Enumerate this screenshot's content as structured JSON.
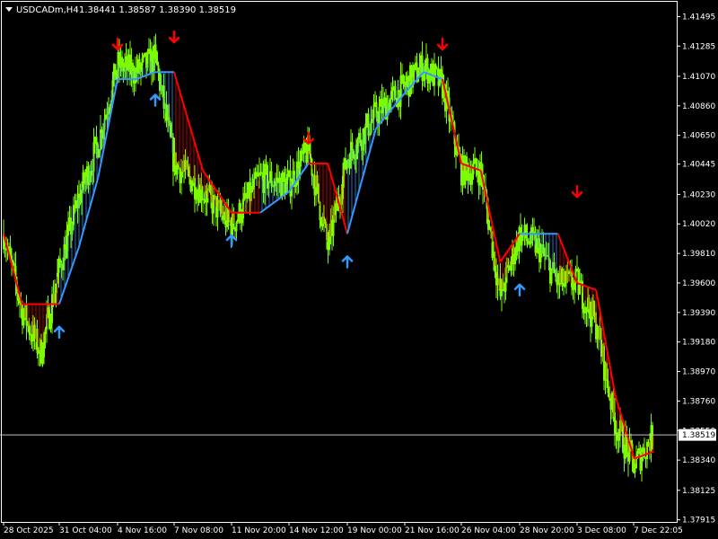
{
  "header": {
    "symbol_timeframe": "USDCADm,H4",
    "ohlc": "1.38441 1.38587 1.38390 1.38519"
  },
  "colors": {
    "background": "#000000",
    "candles": "#7CFC00",
    "trend_up": "#3399ff",
    "trend_down": "#ff0000",
    "arrow_up": "#3399ff",
    "arrow_down": "#ff0000",
    "price_line": "#c0c0c0",
    "axis": "#ffffff"
  },
  "chart_data": {
    "type": "line",
    "title": "",
    "ylim": [
      1.379,
      1.416
    ],
    "y_ticks": [
      "1.41495",
      "1.41285",
      "1.41070",
      "1.40860",
      "1.40650",
      "1.40445",
      "1.40230",
      "1.40020",
      "1.39810",
      "1.39600",
      "1.39390",
      "1.39180",
      "1.38970",
      "1.38760",
      "1.38550",
      "1.38340",
      "1.38125",
      "1.37915"
    ],
    "x_ticks": [
      "28 Oct 2025",
      "31 Oct 04:00",
      "4 Nov 16:00",
      "7 Nov 08:00",
      "11 Nov 20:00",
      "14 Nov 12:00",
      "19 Nov 00:00",
      "21 Nov 16:00",
      "26 Nov 04:00",
      "28 Nov 20:00",
      "3 Dec 08:00",
      "7 Dec 22:05"
    ],
    "current_price": "1.38519",
    "price_path": [
      {
        "t": "28 Oct 2025",
        "v": 1.3995
      },
      {
        "t": "29 Oct 2025",
        "v": 1.394
      },
      {
        "t": "30 Oct 2025",
        "v": 1.391
      },
      {
        "t": "31 Oct 04:00",
        "v": 1.397
      },
      {
        "t": "1 Nov",
        "v": 1.402
      },
      {
        "t": "3 Nov",
        "v": 1.406
      },
      {
        "t": "4 Nov 16:00",
        "v": 1.4115
      },
      {
        "t": "5 Nov",
        "v": 1.411
      },
      {
        "t": "6 Nov",
        "v": 1.412
      },
      {
        "t": "7 Nov 08:00",
        "v": 1.4045
      },
      {
        "t": "10 Nov",
        "v": 1.4025
      },
      {
        "t": "11 Nov 20:00",
        "v": 1.4
      },
      {
        "t": "13 Nov",
        "v": 1.4035
      },
      {
        "t": "14 Nov 12:00",
        "v": 1.403
      },
      {
        "t": "17 Nov",
        "v": 1.4055
      },
      {
        "t": "18 Nov",
        "v": 1.3985
      },
      {
        "t": "19 Nov 00:00",
        "v": 1.405
      },
      {
        "t": "20 Nov",
        "v": 1.408
      },
      {
        "t": "21 Nov 16:00",
        "v": 1.41
      },
      {
        "t": "24 Nov",
        "v": 1.4115
      },
      {
        "t": "25 Nov",
        "v": 1.41
      },
      {
        "t": "26 Nov 04:00",
        "v": 1.404
      },
      {
        "t": "27 Nov",
        "v": 1.404
      },
      {
        "t": "28 Nov",
        "v": 1.395
      },
      {
        "t": "28 Nov 20:00",
        "v": 1.3995
      },
      {
        "t": "1 Dec",
        "v": 1.3985
      },
      {
        "t": "2 Dec",
        "v": 1.396
      },
      {
        "t": "3 Dec 08:00",
        "v": 1.396
      },
      {
        "t": "4 Dec",
        "v": 1.393
      },
      {
        "t": "5 Dec",
        "v": 1.386
      },
      {
        "t": "7 Dec",
        "v": 1.383
      },
      {
        "t": "7 Dec 22:05",
        "v": 1.3852
      }
    ],
    "trend_line": [
      {
        "t": "28 Oct 2025",
        "v": 1.3995,
        "dir": "down"
      },
      {
        "t": "29 Oct 2025",
        "v": 1.3945,
        "dir": "down"
      },
      {
        "t": "30 Oct 2025",
        "v": 1.3945,
        "dir": "down"
      },
      {
        "t": "31 Oct 04:00",
        "v": 1.3945,
        "dir": "up"
      },
      {
        "t": "1 Nov",
        "v": 1.3985,
        "dir": "up"
      },
      {
        "t": "3 Nov",
        "v": 1.4035,
        "dir": "up"
      },
      {
        "t": "4 Nov 16:00",
        "v": 1.4105,
        "dir": "up"
      },
      {
        "t": "5 Nov",
        "v": 1.4105,
        "dir": "up"
      },
      {
        "t": "6 Nov",
        "v": 1.411,
        "dir": "up"
      },
      {
        "t": "7 Nov 08:00",
        "v": 1.411,
        "dir": "down"
      },
      {
        "t": "10 Nov",
        "v": 1.404,
        "dir": "down"
      },
      {
        "t": "11 Nov 20:00",
        "v": 1.401,
        "dir": "down"
      },
      {
        "t": "13 Nov",
        "v": 1.401,
        "dir": "up"
      },
      {
        "t": "14 Nov 12:00",
        "v": 1.4025,
        "dir": "up"
      },
      {
        "t": "17 Nov",
        "v": 1.4045,
        "dir": "down"
      },
      {
        "t": "18 Nov",
        "v": 1.4045,
        "dir": "down"
      },
      {
        "t": "19 Nov 00:00",
        "v": 1.3995,
        "dir": "up"
      },
      {
        "t": "20 Nov",
        "v": 1.407,
        "dir": "up"
      },
      {
        "t": "21 Nov 16:00",
        "v": 1.4095,
        "dir": "up"
      },
      {
        "t": "24 Nov",
        "v": 1.411,
        "dir": "up"
      },
      {
        "t": "25 Nov",
        "v": 1.4105,
        "dir": "down"
      },
      {
        "t": "26 Nov 04:00",
        "v": 1.4045,
        "dir": "down"
      },
      {
        "t": "27 Nov",
        "v": 1.404,
        "dir": "down"
      },
      {
        "t": "28 Nov",
        "v": 1.3975,
        "dir": "down"
      },
      {
        "t": "28 Nov 20:00",
        "v": 1.3995,
        "dir": "up"
      },
      {
        "t": "1 Dec",
        "v": 1.3995,
        "dir": "up"
      },
      {
        "t": "2 Dec",
        "v": 1.3995,
        "dir": "down"
      },
      {
        "t": "3 Dec 08:00",
        "v": 1.396,
        "dir": "down"
      },
      {
        "t": "4 Dec",
        "v": 1.3955,
        "dir": "down"
      },
      {
        "t": "5 Dec",
        "v": 1.388,
        "dir": "down"
      },
      {
        "t": "7 Dec",
        "v": 1.3835,
        "dir": "down"
      },
      {
        "t": "7 Dec 22:05",
        "v": 1.384,
        "dir": "down"
      }
    ],
    "arrows": [
      {
        "type": "up",
        "t": "31 Oct 04:00",
        "v": 1.3925
      },
      {
        "type": "down",
        "t": "4 Nov 16:00",
        "v": 1.413
      },
      {
        "type": "down",
        "t": "7 Nov 08:00",
        "v": 1.4135
      },
      {
        "type": "up",
        "t": "6 Nov",
        "v": 1.409
      },
      {
        "type": "up",
        "t": "11 Nov 20:00",
        "v": 1.399
      },
      {
        "type": "down",
        "t": "17 Nov",
        "v": 1.4063
      },
      {
        "type": "up",
        "t": "19 Nov 00:00",
        "v": 1.3975
      },
      {
        "type": "down",
        "t": "25 Nov",
        "v": 1.413
      },
      {
        "type": "up",
        "t": "28 Nov 20:00",
        "v": 1.3955
      },
      {
        "type": "down",
        "t": "3 Dec 08:00",
        "v": 1.4025
      }
    ]
  }
}
